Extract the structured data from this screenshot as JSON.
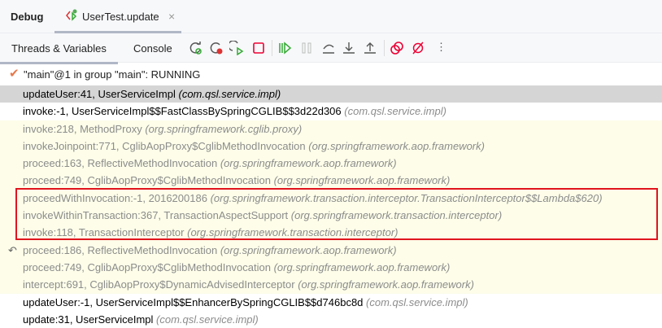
{
  "header": {
    "title": "Debug",
    "tab_label": "UserTest.update"
  },
  "toolbar": {
    "tabs": [
      "Threads & Variables",
      "Console"
    ]
  },
  "status": "\"main\"@1 in group \"main\": RUNNING",
  "frames": [
    {
      "method": "updateUser:41, UserServiceImpl",
      "pkg": "(com.qsl.service.impl)",
      "kind": "sel"
    },
    {
      "method": "invoke:-1, UserServiceImpl$$FastClassBySpringCGLIB$$3d22d306",
      "pkg": "(com.qsl.service.impl)",
      "kind": ""
    },
    {
      "method": "invoke:218, MethodProxy",
      "pkg": "(org.springframework.cglib.proxy)",
      "kind": "lib"
    },
    {
      "method": "invokeJoinpoint:771, CglibAopProxy$CglibMethodInvocation",
      "pkg": "(org.springframework.aop.framework)",
      "kind": "lib"
    },
    {
      "method": "proceed:163, ReflectiveMethodInvocation",
      "pkg": "(org.springframework.aop.framework)",
      "kind": "lib"
    },
    {
      "method": "proceed:749, CglibAopProxy$CglibMethodInvocation",
      "pkg": "(org.springframework.aop.framework)",
      "kind": "lib"
    },
    {
      "method": "proceedWithInvocation:-1, 2016200186",
      "pkg": "(org.springframework.transaction.interceptor.TransactionInterceptor$$Lambda$620)",
      "kind": "lib"
    },
    {
      "method": "invokeWithinTransaction:367, TransactionAspectSupport",
      "pkg": "(org.springframework.transaction.interceptor)",
      "kind": "lib"
    },
    {
      "method": "invoke:118, TransactionInterceptor",
      "pkg": "(org.springframework.transaction.interceptor)",
      "kind": "lib"
    },
    {
      "method": "proceed:186, ReflectiveMethodInvocation",
      "pkg": "(org.springframework.aop.framework)",
      "kind": "lib",
      "ret": true
    },
    {
      "method": "proceed:749, CglibAopProxy$CglibMethodInvocation",
      "pkg": "(org.springframework.aop.framework)",
      "kind": "lib"
    },
    {
      "method": "intercept:691, CglibAopProxy$DynamicAdvisedInterceptor",
      "pkg": "(org.springframework.aop.framework)",
      "kind": "lib"
    },
    {
      "method": "updateUser:-1, UserServiceImpl$$EnhancerBySpringCGLIB$$d746bc8d",
      "pkg": "(com.qsl.service.impl)",
      "kind": ""
    },
    {
      "method": "update:31, UserServiceImpl",
      "pkg": "(com.qsl.service.impl)",
      "kind": ""
    }
  ],
  "colors": {
    "highlight": "#e0141e",
    "library_bg": "#fdfde9",
    "selected_bg": "#d5d5d5"
  }
}
